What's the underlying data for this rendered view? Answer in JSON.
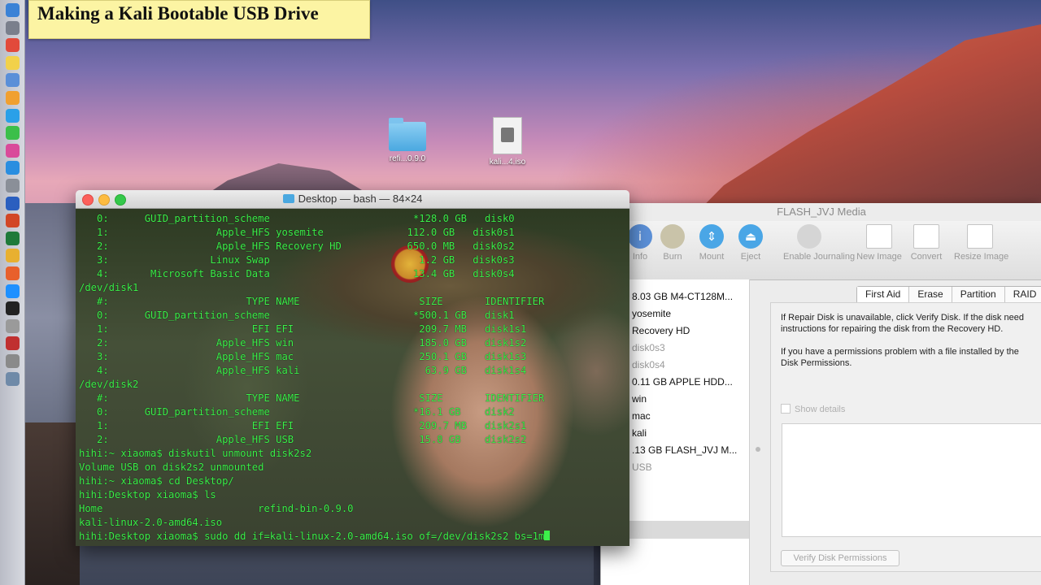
{
  "banner": {
    "title": "Making a Kali Bootable USB Drive"
  },
  "desktop": {
    "icons": [
      {
        "label": "refi...0.9.0",
        "icon": "folder-icon"
      },
      {
        "label": "kali...4.iso",
        "icon": "iso-file-icon"
      }
    ]
  },
  "dock": {
    "items": [
      "finder-icon",
      "launchpad-icon",
      "calendar-icon",
      "notes-icon",
      "preview-icon",
      "photos-icon",
      "messages-icon",
      "facetime-icon",
      "itunes-icon",
      "app-store-icon",
      "system-preferences-icon",
      "word-icon",
      "powerpoint-icon",
      "excel-icon",
      "chrome-icon",
      "firefox-icon",
      "safari-icon",
      "terminal-icon",
      "calculator-icon",
      "photo-booth-icon",
      "disk-utility-icon",
      "trash-icon"
    ]
  },
  "terminal": {
    "title": "Desktop — bash — 84×24",
    "lines": [
      "   0:      GUID_partition_scheme                        *128.0 GB   disk0",
      "   1:                  Apple_HFS yosemite              112.0 GB   disk0s1",
      "   2:                  Apple_HFS Recovery HD           650.0 MB   disk0s2",
      "   3:                 Linux Swap                         1.2 GB   disk0s3",
      "   4:       Microsoft Basic Data                        13.4 GB   disk0s4",
      "/dev/disk1",
      "   #:                       TYPE NAME                    SIZE       IDENTIFIER",
      "   0:      GUID_partition_scheme                        *500.1 GB   disk1",
      "   1:                        EFI EFI                     209.7 MB   disk1s1",
      "   2:                  Apple_HFS win                     185.0 GB   disk1s2",
      "   3:                  Apple_HFS mac                     250.1 GB   disk1s3",
      "   4:                  Apple_HFS kali                     63.9 GB   disk1s4",
      "/dev/disk2",
      "   #:                       TYPE NAME                    SIZE       IDENTIFIER",
      "   0:      GUID_partition_scheme                        *16.1 GB    disk2",
      "   1:                        EFI EFI                     209.7 MB   disk2s1",
      "   2:                  Apple_HFS USB                     15.8 GB    disk2s2",
      "hihi:~ xiaoma$ diskutil unmount disk2s2",
      "Volume USB on disk2s2 unmounted",
      "hihi:~ xiaoma$ cd Desktop/",
      "hihi:Desktop xiaoma$ ls",
      "Home                          refind-bin-0.9.0",
      "kali-linux-2.0-amd64.iso",
      "hihi:Desktop xiaoma$ sudo dd if=kali-linux-2.0-amd64.iso of=/dev/disk2s2 bs=1m"
    ]
  },
  "disk_utility": {
    "title": "FLASH_JVJ Media",
    "toolbar": [
      {
        "label": "Info",
        "icon": "info-icon",
        "glyph": "i",
        "color": "#5b8fd6"
      },
      {
        "label": "Burn",
        "icon": "burn-icon",
        "glyph": "",
        "color": "#c9c3a9"
      },
      {
        "label": "Mount",
        "icon": "mount-icon",
        "glyph": "⇕",
        "color": "#4aa6e6"
      },
      {
        "label": "Eject",
        "icon": "eject-icon",
        "glyph": "⏏",
        "color": "#4aa6e6"
      },
      {
        "label": "Enable Journaling",
        "icon": "journaling-icon",
        "glyph": "",
        "color": "#d5d5d5"
      },
      {
        "label": "New Image",
        "icon": "new-image-icon",
        "glyph": "",
        "color": "#ffffff"
      },
      {
        "label": "Convert",
        "icon": "convert-icon",
        "glyph": "",
        "color": "#ffffff"
      },
      {
        "label": "Resize Image",
        "icon": "resize-image-icon",
        "glyph": "",
        "color": "#ffffff"
      }
    ],
    "sidebar": [
      {
        "label": "8.03 GB M4-CT128M...",
        "dim": false
      },
      {
        "label": "yosemite",
        "dim": false
      },
      {
        "label": "Recovery HD",
        "dim": false
      },
      {
        "label": "disk0s3",
        "dim": true
      },
      {
        "label": "disk0s4",
        "dim": true
      },
      {
        "label": "0.11 GB APPLE HDD...",
        "dim": false
      },
      {
        "label": "win",
        "dim": false
      },
      {
        "label": "mac",
        "dim": false
      },
      {
        "label": "kali",
        "dim": false
      },
      {
        "label": ".13 GB FLASH_JVJ M...",
        "dim": false
      },
      {
        "label": "USB",
        "dim": true
      }
    ],
    "tabs": [
      "First Aid",
      "Erase",
      "Partition",
      "RAID"
    ],
    "help_lines": [
      "If Repair Disk is unavailable, click Verify Disk. If the disk need",
      "instructions for repairing the disk from the Recovery HD.",
      "If you have a permissions problem with a file installed by the",
      "Disk Permissions."
    ],
    "show_details": "Show details",
    "verify_permissions": "Verify Disk Permissions"
  }
}
